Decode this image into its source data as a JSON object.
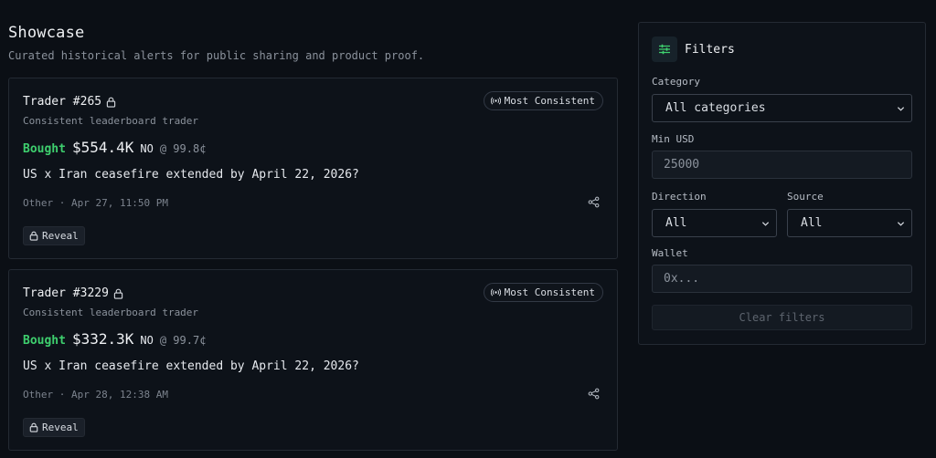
{
  "page": {
    "title": "Showcase",
    "subtitle": "Curated historical alerts for public sharing and product proof."
  },
  "colors": {
    "background": "#0b0f15",
    "card": "#0d1219",
    "border": "#242a33",
    "bought": "#3ecf6e",
    "accent_icon": "#3ecf6e"
  },
  "alerts": [
    {
      "trader": "Trader #265",
      "badge": "Most Consistent",
      "description": "Consistent leaderboard trader",
      "action": "Bought",
      "amount": "$554.4K",
      "side": "NO",
      "price": "@ 99.8¢",
      "market": "US x Iran ceasefire extended by April 22, 2026?",
      "meta": "Other · Apr 27, 11:50 PM",
      "reveal_label": "Reveal"
    },
    {
      "trader": "Trader #3229",
      "badge": "Most Consistent",
      "description": "Consistent leaderboard trader",
      "action": "Bought",
      "amount": "$332.3K",
      "side": "NO",
      "price": "@ 99.7¢",
      "market": "US x Iran ceasefire extended by April 22, 2026?",
      "meta": "Other · Apr 28, 12:38 AM",
      "reveal_label": "Reveal"
    }
  ],
  "filters": {
    "title": "Filters",
    "icon": "sliders-icon",
    "category_label": "Category",
    "category_value": "All categories",
    "min_usd_label": "Min USD",
    "min_usd_value": "25000",
    "direction_label": "Direction",
    "direction_value": "All",
    "source_label": "Source",
    "source_value": "All",
    "wallet_label": "Wallet",
    "wallet_placeholder": "0x...",
    "clear_label": "Clear filters"
  }
}
